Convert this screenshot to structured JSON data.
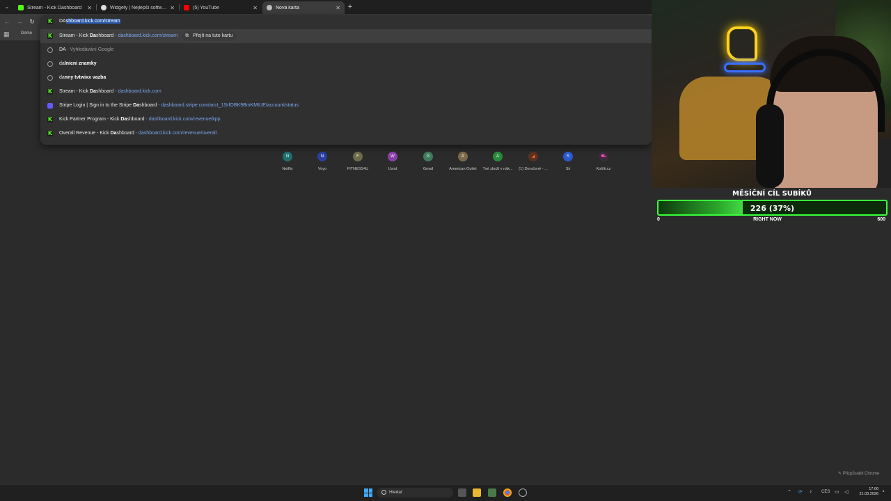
{
  "browser": {
    "tabs": [
      {
        "label": "Stream - Kick Dashboard",
        "favicon": "kick-icon",
        "color": "#53fc18"
      },
      {
        "label": "Widgety | Nejlepší software pro",
        "favicon": "widgety-icon",
        "color": "#dddddd"
      },
      {
        "label": "(5) YouTube",
        "favicon": "youtube-icon",
        "color": "#ff0000"
      },
      {
        "label": "Nová karta",
        "favicon": "chrome-icon",
        "color": "#bbbbbb",
        "active": true
      }
    ],
    "bookmark_label": "Domo",
    "omnibox": {
      "typed": "DA",
      "autocomplete": "shboard.kick.com/stream"
    },
    "suggestions": [
      {
        "icon": "kick-icon",
        "title_pre": "Stream - Kick ",
        "title_bold": "Da",
        "title_post": "shboard",
        "sep": " - ",
        "url": "dashboard.kick.com/stream",
        "action": "Přejít na tuto kartu",
        "highlighted": true
      },
      {
        "icon": "search-icon",
        "title": "DA",
        "sep": " - ",
        "muted": "Vyhledávání Google"
      },
      {
        "icon": "history-icon",
        "pre": "da",
        "bold": "lnicni znamky"
      },
      {
        "icon": "history-icon",
        "pre": "da",
        "bold": "nny tvtwixx vazba"
      },
      {
        "icon": "kick-icon",
        "title_pre": "Stream - Kick ",
        "title_bold": "Da",
        "title_post": "shboard",
        "sep": " - ",
        "url": "dashboard.kick.com"
      },
      {
        "icon": "stripe-icon",
        "title_pre": "Stripe Login | Sign in to the Stripe ",
        "title_bold": "Da",
        "title_post": "shboard",
        "sep": " - ",
        "url": "dashboard.stripe.com/acct_1SrfOBK9BmKMtUE/account/status"
      },
      {
        "icon": "kick-icon",
        "title_pre": "Kick Partner Program - Kick ",
        "title_bold": "Da",
        "title_post": "shboard",
        "sep": " - ",
        "url": "dashboard.kick.com/revenue/kpp"
      },
      {
        "icon": "kick-icon",
        "title_pre": "Overall Revenue - Kick ",
        "title_bold": "Da",
        "title_post": "shboard",
        "sep": " - ",
        "url": "dashboard.kick.com/revenue/overall"
      }
    ],
    "shortcuts": [
      {
        "name": "Netflix",
        "letter": "N",
        "color": "#1f6f6f"
      },
      {
        "name": "Voyo",
        "letter": "N",
        "color": "#2a3fa0"
      },
      {
        "name": "FITNESS4U",
        "letter": "F",
        "color": "#6b6b4a"
      },
      {
        "name": "Úvod",
        "letter": "W",
        "color": "#8a3fa8"
      },
      {
        "name": "Gmail",
        "letter": "G",
        "color": "#3f7a5a"
      },
      {
        "name": "American Outlet",
        "letter": "A",
        "color": "#7a6a4a"
      },
      {
        "name": "Tvé zboží v nák...",
        "letter": "A",
        "color": "#2a8a3a"
      },
      {
        "name": "(1) Doručené - ...",
        "letter": "◢",
        "color": "#5a3020"
      },
      {
        "name": "Sk",
        "letter": "S",
        "color": "#2a5ad0"
      },
      {
        "name": "Košík.cz",
        "letter": "🛒",
        "color": "#3a2a3a"
      }
    ],
    "customize_label": "Přizpůsobit Chrome"
  },
  "goal": {
    "title": "MĚSÍČNÍ CÍL SUBÍKŮ",
    "current_label": "226 (37%)",
    "progress": 0.37,
    "min_label": "0",
    "now_label": "RIGHT NOW",
    "max_label": "600"
  },
  "taskbar": {
    "search_placeholder": "Hledat",
    "language": "CES",
    "time": "17:00",
    "date": "21.03.2026"
  }
}
